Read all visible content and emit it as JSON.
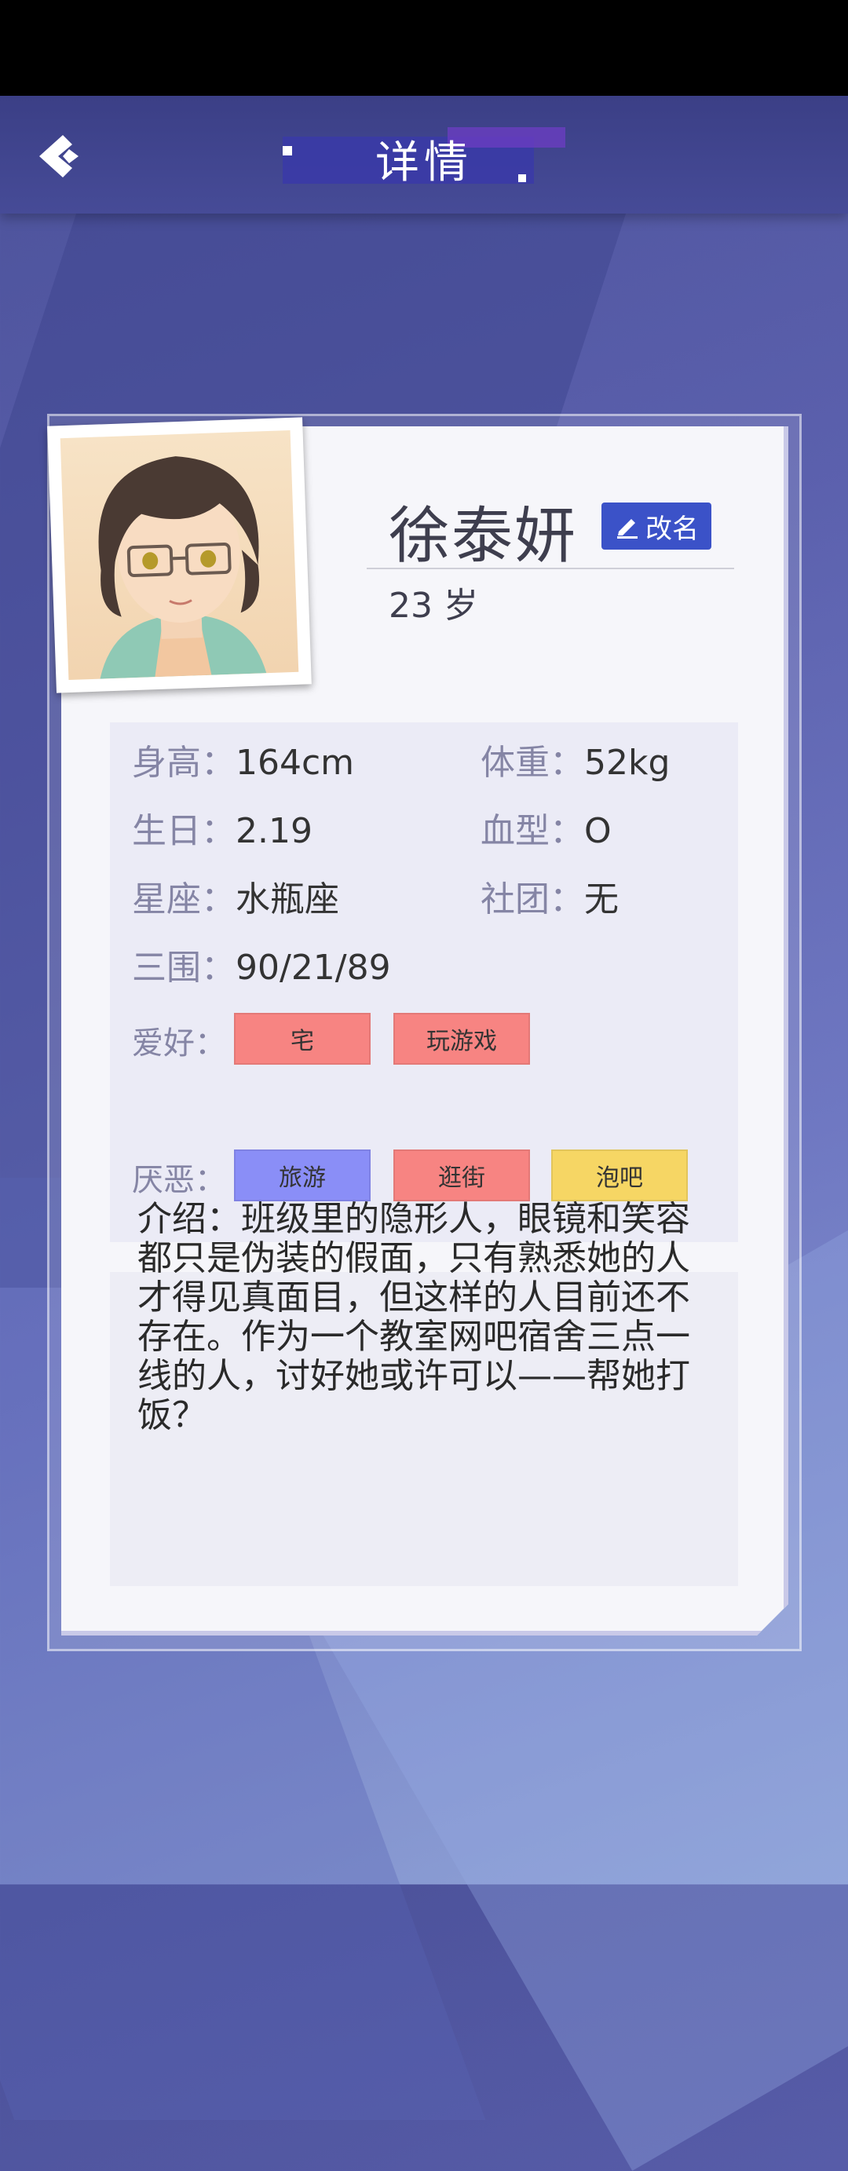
{
  "header": {
    "title": "详情"
  },
  "profile": {
    "name": "徐泰妍",
    "rename_label": "改名",
    "age": "23 岁"
  },
  "stats": {
    "height": {
      "label": "身高：",
      "value": "164cm"
    },
    "weight": {
      "label": "体重：",
      "value": "52kg"
    },
    "birthday": {
      "label": "生日：",
      "value": "2.19"
    },
    "blood": {
      "label": "血型：",
      "value": "O"
    },
    "constellation": {
      "label": "星座：",
      "value": "水瓶座"
    },
    "club": {
      "label": "社团：",
      "value": "无"
    },
    "measurements": {
      "label": "三围：",
      "value": "90/21/89"
    }
  },
  "hobbies": {
    "label": "爱好：",
    "items": [
      "宅",
      "玩游戏"
    ]
  },
  "dislikes": {
    "label": "厌恶：",
    "items": [
      "旅游",
      "逛街",
      "泡吧"
    ]
  },
  "intro": "介绍：班级里的隐形人，眼镜和笑容都只是伪装的假面，只有熟悉她的人才得见真面目，但这样的人目前还不存在。作为一个教室网吧宿舍三点一线的人，讨好她或许可以——帮她打饭？",
  "colors": {
    "accent": "#3b52c8",
    "tag_red": "#f78482",
    "tag_blue": "#8a8ef7",
    "tag_yellow": "#f6d664"
  }
}
